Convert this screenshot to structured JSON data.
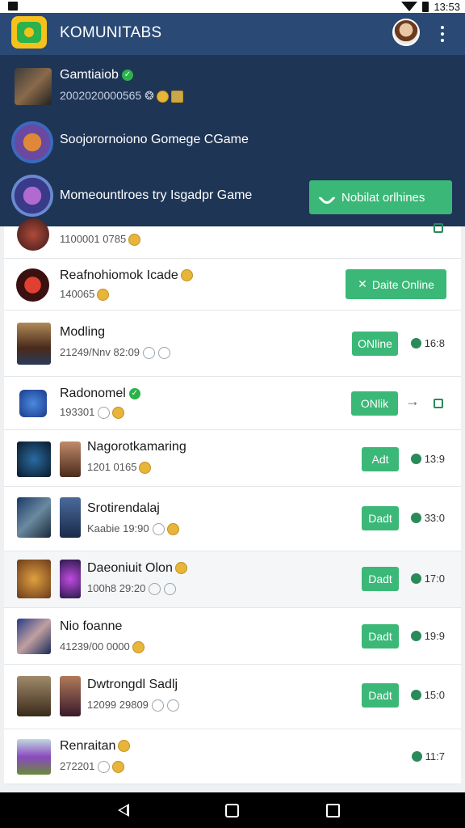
{
  "status_bar": {
    "time": "13:53"
  },
  "app_bar": {
    "title": "KOMUNITABS"
  },
  "dropdown": {
    "items": [
      {
        "name": "Gamtiaiob",
        "sub": "2002020000565"
      },
      {
        "name": "Soojorornoiono Gomege CGame"
      },
      {
        "name": "Momeountlroes try Isgadpr Game"
      }
    ],
    "button_label": "Nobilat orlhines"
  },
  "list": [
    {
      "name": "",
      "sub": "1100001 0785"
    },
    {
      "name": "Reafnohiomok Icade",
      "sub": "140065",
      "button": "Daite Online"
    },
    {
      "name": "Modling",
      "sub": "21249/Nnv 82:09",
      "button": "ONline",
      "time": "16:8"
    },
    {
      "name": "Radonomel",
      "sub": "193301",
      "button": "ONlik"
    },
    {
      "name": "Nagorotkamaring",
      "sub": "1201 0165",
      "button": "Adt",
      "time": "13:9"
    },
    {
      "name": "Srotirendalaj",
      "sub": "Kaabie 19:90",
      "button": "Dadt",
      "time": "33:0"
    },
    {
      "name": "Daeoniuit Olon",
      "sub": "100h8 29:20",
      "button": "Dadt",
      "time": "17:0"
    },
    {
      "name": "Nio foanne",
      "sub": "41239/00 0000",
      "button": "Dadt",
      "time": "19:9"
    },
    {
      "name": "Dwtrongdl Sadlj",
      "sub": "12099 29809",
      "button": "Dadt",
      "time": "15:0"
    },
    {
      "name": "Renraitan",
      "sub": "272201",
      "time": "11:7"
    }
  ],
  "colors": {
    "app_bar": "#2a4a75",
    "dropdown": "#1e3556",
    "accent_green": "#3bb877"
  }
}
